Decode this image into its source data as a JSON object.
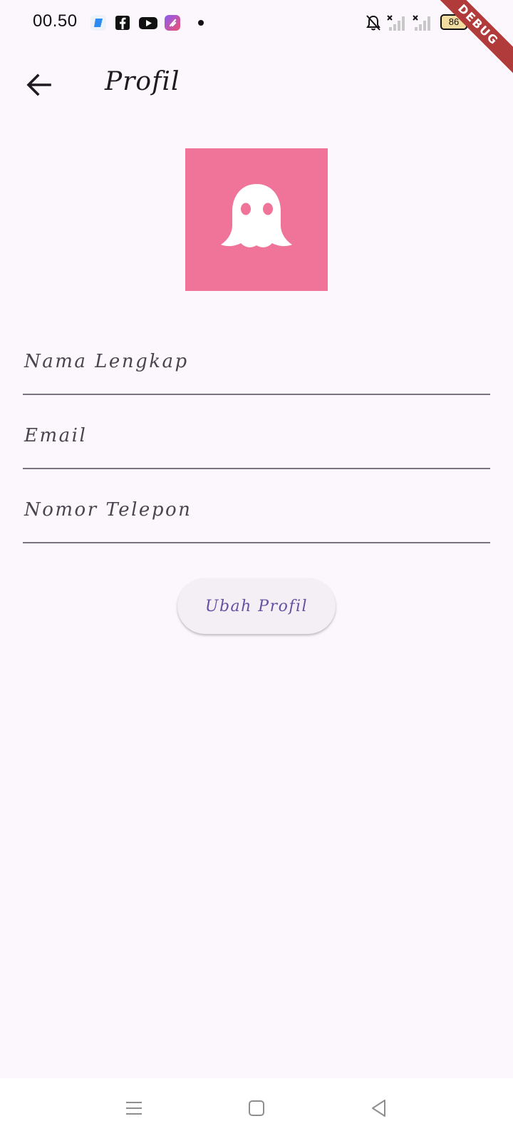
{
  "status_bar": {
    "time": "00.50",
    "battery_level": "86",
    "notification_icons": [
      "app-icon",
      "facebook-icon",
      "youtube-icon",
      "shortcut-app-icon",
      "dot-icon"
    ],
    "status_icons": [
      "bell-muted-icon",
      "signal-no-service-icon",
      "signal-no-service-icon",
      "battery-icon",
      "charging-icon"
    ]
  },
  "debug_banner": "DEBUG",
  "app_bar": {
    "title": "Profil",
    "back_icon": "arrow-back-icon"
  },
  "avatar": {
    "icon": "ghost-icon",
    "background": "#f07499"
  },
  "form": {
    "fields": [
      {
        "label": "Nama Lengkap",
        "value": ""
      },
      {
        "label": "Email",
        "value": ""
      },
      {
        "label": "Nomor Telepon",
        "value": ""
      }
    ],
    "submit_label": "Ubah Profil"
  },
  "nav_bar": {
    "buttons": [
      "menu-icon",
      "home-square-icon",
      "back-triangle-icon"
    ]
  },
  "colors": {
    "background": "#fcf6fd",
    "accent": "#6750a4",
    "avatar": "#f07499",
    "debug_ribbon": "#b13a3a"
  }
}
